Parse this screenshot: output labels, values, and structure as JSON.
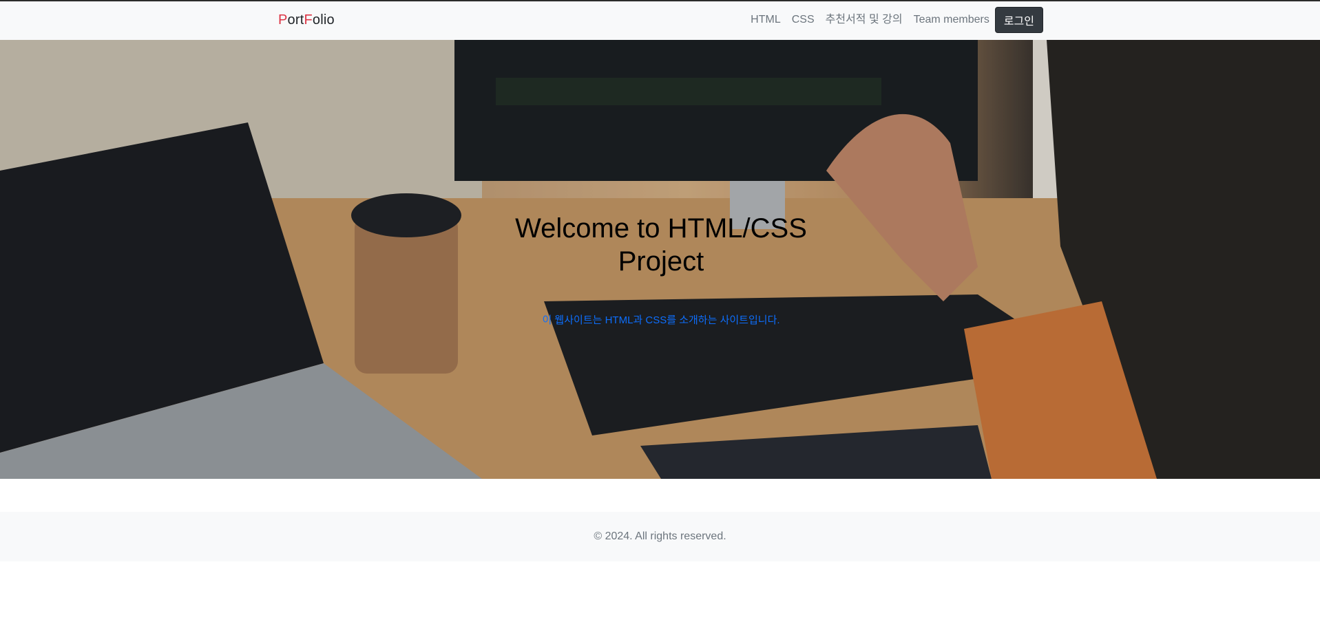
{
  "navbar": {
    "brand": {
      "p": "P",
      "ort": "ort",
      "f": "F",
      "olio": "olio"
    },
    "links": [
      "HTML",
      "CSS",
      "추천서적 및 강의",
      "Team members"
    ],
    "login_label": "로그인"
  },
  "hero": {
    "title": "Welcome to HTML/CSS Project",
    "subtitle": "이 웹사이트는 HTML과 CSS를 소개하는 사이트입니다."
  },
  "footer": {
    "copyright": "© 2024. All rights reserved."
  },
  "colors": {
    "brand_accent": "#dc3545",
    "navbar_bg": "#f8f9fa",
    "login_bg": "#343a40",
    "subtitle": "#0d6efd"
  }
}
